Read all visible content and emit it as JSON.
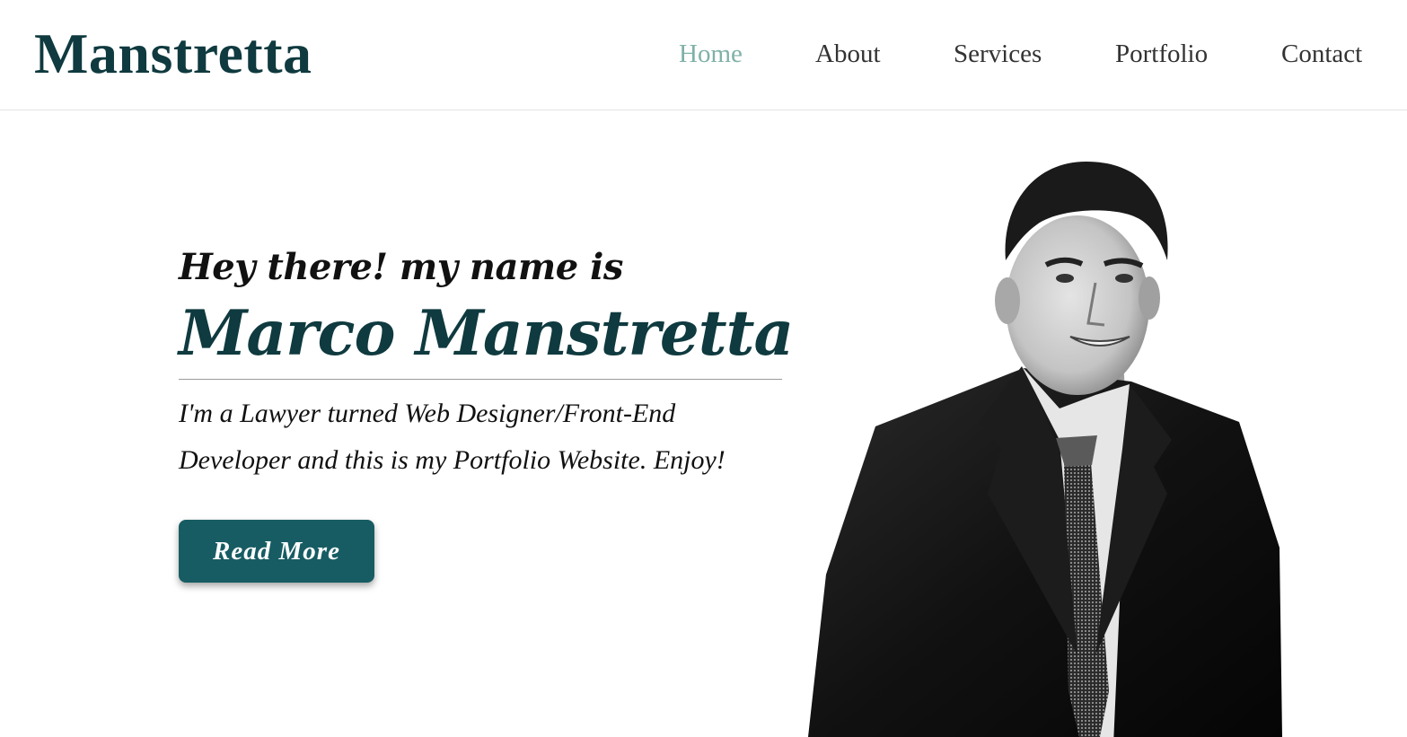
{
  "header": {
    "logo": "Manstretta",
    "nav": [
      {
        "label": "Home",
        "active": true
      },
      {
        "label": "About",
        "active": false
      },
      {
        "label": "Services",
        "active": false
      },
      {
        "label": "Portfolio",
        "active": false
      },
      {
        "label": "Contact",
        "active": false
      }
    ]
  },
  "hero": {
    "greeting": "Hey there! my name is",
    "name": "Marco Manstretta",
    "intro": "I'm a Lawyer turned Web Designer/Front-End Developer and this is my Portfolio Website. Enjoy!",
    "button_label": "Read More",
    "photo": "portrait-photo"
  },
  "colors": {
    "brand": "#0f3a3f",
    "active_nav": "#7fb1a8",
    "button": "#175c63",
    "text": "#333333"
  }
}
